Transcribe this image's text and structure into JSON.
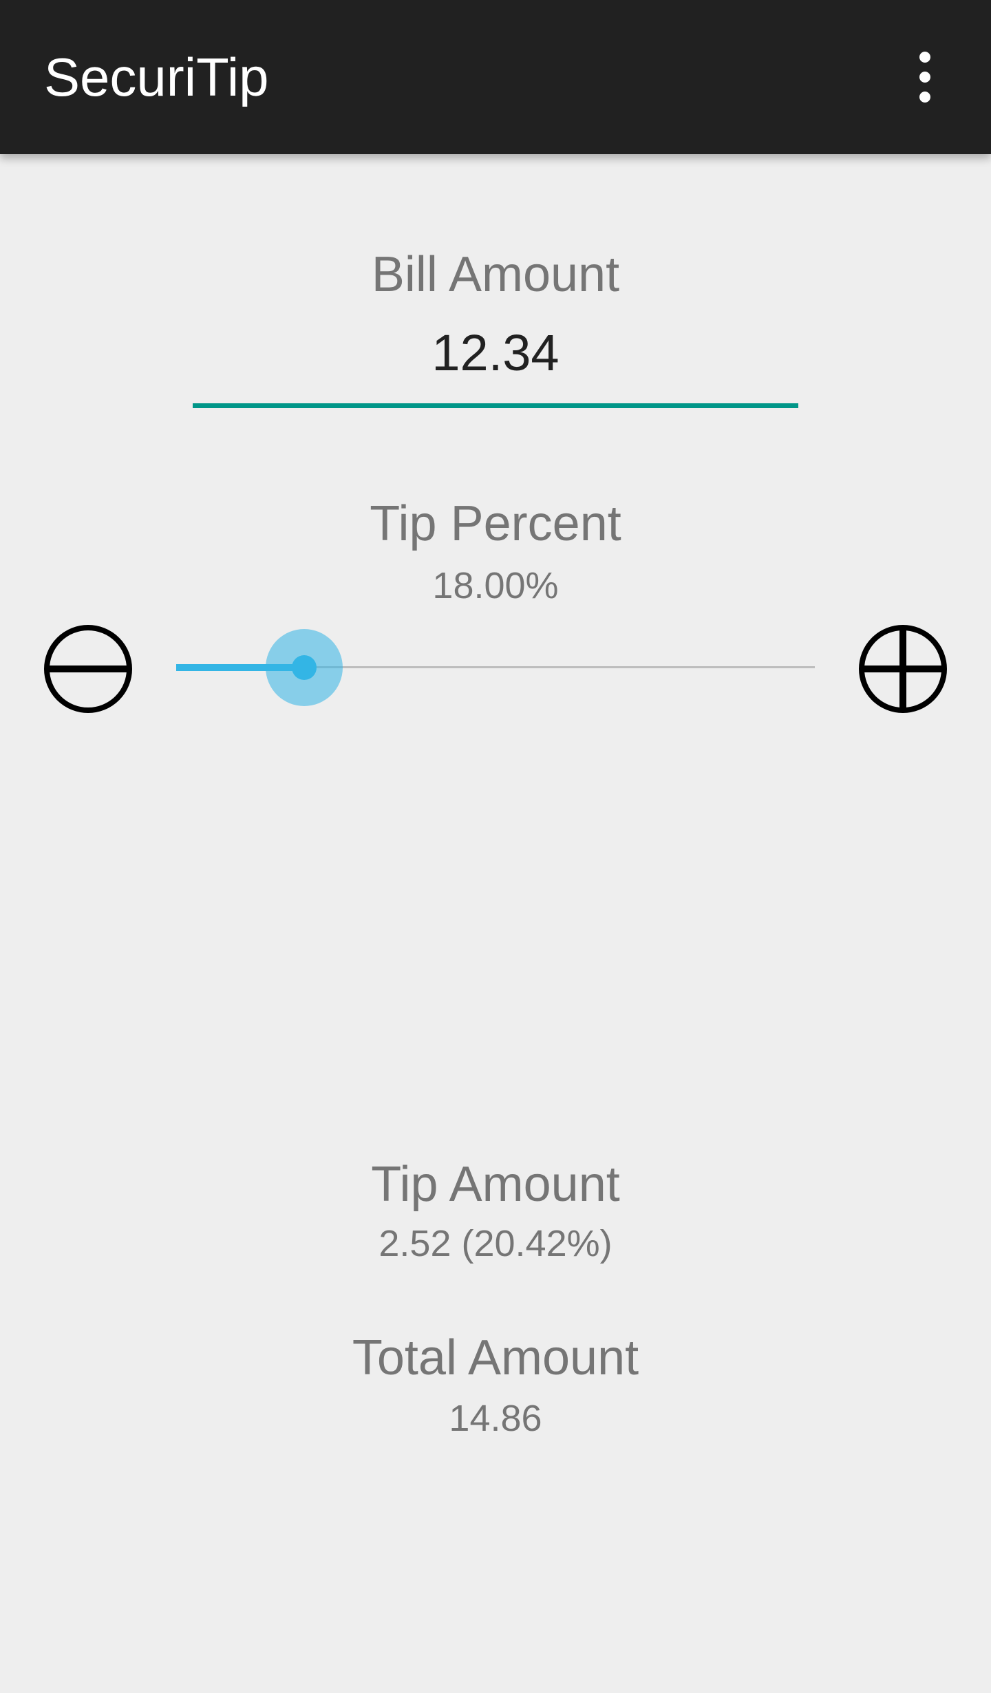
{
  "app": {
    "title": "SecuriTip",
    "overflow_icon": "more-vert-icon"
  },
  "bill": {
    "label": "Bill Amount",
    "value": "12.34",
    "underline_color": "#009688"
  },
  "tip_percent": {
    "label": "Tip Percent",
    "value": "18.00%",
    "decrease_icon": "minus-circle-icon",
    "increase_icon": "plus-circle-icon",
    "slider_level": 0.2,
    "slider_color": "#33b5e5"
  },
  "tip_amount": {
    "label": "Tip Amount",
    "value": "2.52 (20.42%)"
  },
  "total_amount": {
    "label": "Total Amount",
    "value": "14.86"
  }
}
